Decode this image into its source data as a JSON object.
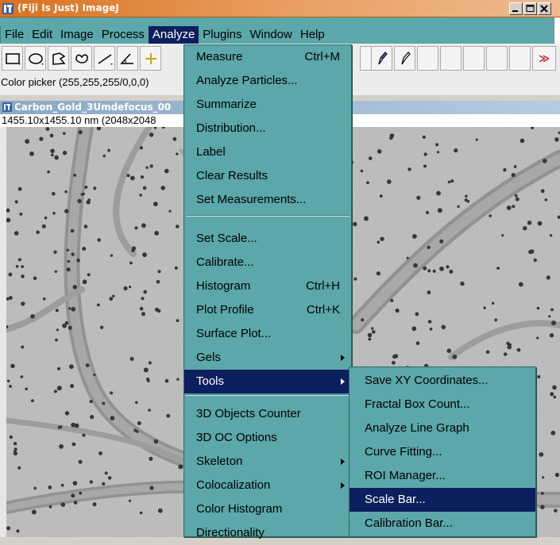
{
  "window": {
    "title": "(Fiji Is Just) ImageJ"
  },
  "menubar": {
    "items": [
      "File",
      "Edit",
      "Image",
      "Process",
      "Analyze",
      "Plugins",
      "Window",
      "Help"
    ],
    "active": "Analyze"
  },
  "toolbar": {
    "tools": [
      "rectangle-tool",
      "oval-tool",
      "polygon-tool",
      "freehand-tool",
      "line-tool",
      "angle-tool",
      "point-tool"
    ],
    "right_tools": [
      "pencil-tool",
      "brush-tool"
    ],
    "more_label": "≫"
  },
  "status": {
    "text": "Color picker (255,255,255/0,0,0)"
  },
  "image_window": {
    "title": "Carbon_Gold_3Umdefocus_00",
    "info": "1455.10x1455.10 nm (2048x2048"
  },
  "analyze_menu": {
    "items": [
      {
        "label": "Measure",
        "shortcut": "Ctrl+M"
      },
      {
        "label": "Analyze Particles..."
      },
      {
        "label": "Summarize"
      },
      {
        "label": "Distribution..."
      },
      {
        "label": "Label"
      },
      {
        "label": "Clear Results"
      },
      {
        "label": "Set Measurements..."
      },
      {
        "label": "Set Scale..."
      },
      {
        "label": "Calibrate..."
      },
      {
        "label": "Histogram",
        "shortcut": "Ctrl+H"
      },
      {
        "label": "Plot Profile",
        "shortcut": "Ctrl+K"
      },
      {
        "label": "Surface Plot..."
      },
      {
        "label": "Gels"
      },
      {
        "label": "Tools"
      },
      {
        "label": "3D Objects Counter"
      },
      {
        "label": "3D OC Options"
      },
      {
        "label": "Skeleton"
      },
      {
        "label": "Colocalization"
      },
      {
        "label": "Color Histogram"
      },
      {
        "label": "Directionality"
      }
    ],
    "selected": "Tools"
  },
  "tools_submenu": {
    "items": [
      "Save XY Coordinates...",
      "Fractal Box Count...",
      "Analyze Line Graph",
      "Curve Fitting...",
      "ROI Manager...",
      "Scale Bar...",
      "Calibration Bar..."
    ],
    "selected": "Scale Bar..."
  },
  "colors": {
    "menu_bg": "#5ba7a9",
    "menu_selected": "#0c1f5e",
    "title_bar": "#d8721f"
  }
}
